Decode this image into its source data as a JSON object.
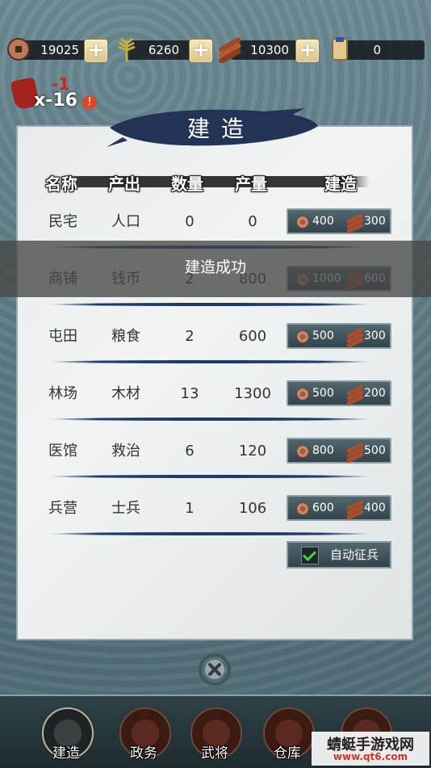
{
  "resources": [
    {
      "icon": "copper-coin-icon",
      "value": "19025"
    },
    {
      "icon": "grain-icon",
      "value": "6260"
    },
    {
      "icon": "wood-icon",
      "value": "10300"
    },
    {
      "icon": "scroll-icon",
      "value": "0"
    }
  ],
  "plus_label": "+",
  "alert": {
    "delta": "-1",
    "count": "x-16",
    "mark": "!"
  },
  "panel": {
    "title": "建造",
    "headers": {
      "name": "名称",
      "output": "产出",
      "count": "数量",
      "production": "产量",
      "build": "建造"
    },
    "rows": [
      {
        "name": "民宅",
        "output": "人口",
        "count": "0",
        "production": "0",
        "coin_cost": "400",
        "wood_cost": "300"
      },
      {
        "name": "商铺",
        "output": "钱币",
        "count": "2",
        "production": "800",
        "coin_cost": "1000",
        "wood_cost": "600"
      },
      {
        "name": "屯田",
        "output": "粮食",
        "count": "2",
        "production": "600",
        "coin_cost": "500",
        "wood_cost": "300"
      },
      {
        "name": "林场",
        "output": "木材",
        "count": "13",
        "production": "1300",
        "coin_cost": "500",
        "wood_cost": "200"
      },
      {
        "name": "医馆",
        "output": "救治",
        "count": "6",
        "production": "120",
        "coin_cost": "800",
        "wood_cost": "500"
      },
      {
        "name": "兵营",
        "output": "士兵",
        "count": "1",
        "production": "106",
        "coin_cost": "600",
        "wood_cost": "400"
      }
    ],
    "auto_recruit": {
      "label": "自动征兵",
      "checked": true
    }
  },
  "toast": "建造成功",
  "nav": [
    {
      "label": "建造",
      "active": true
    },
    {
      "label": "政务",
      "active": false
    },
    {
      "label": "武将",
      "active": false
    },
    {
      "label": "仓库",
      "active": false
    },
    {
      "label": "",
      "active": false
    }
  ],
  "watermark": {
    "line1": "蜻蜓手游戏网",
    "line2": "www.qt6.com"
  },
  "colors": {
    "divider": "#1e3a68",
    "toast_bg": "#464646",
    "check": "#3fd34a"
  }
}
